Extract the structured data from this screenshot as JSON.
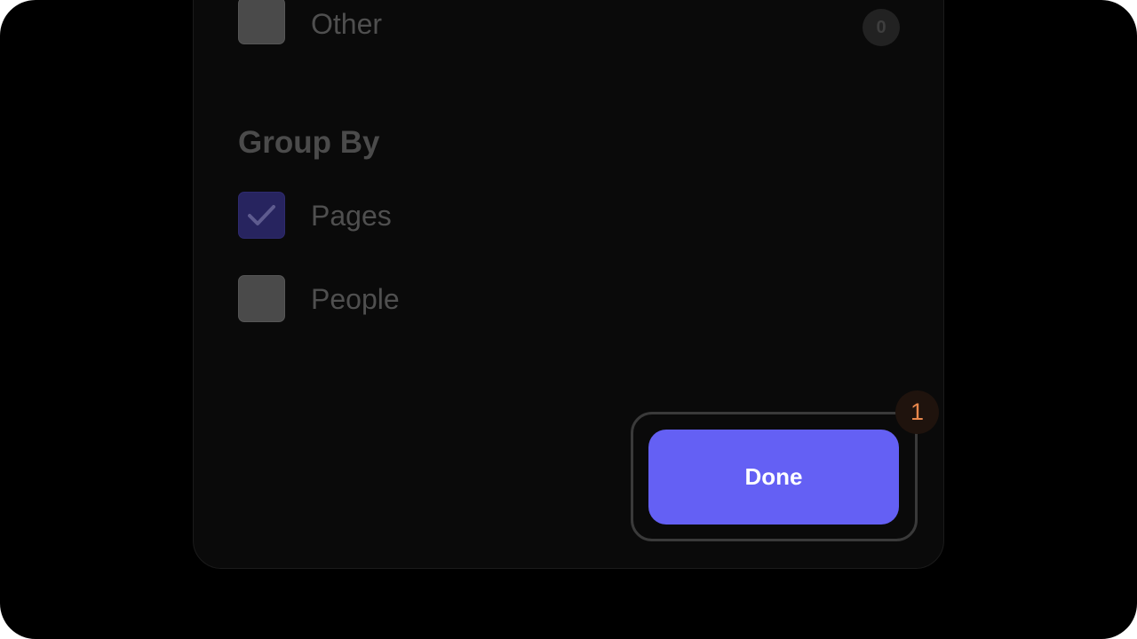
{
  "filters": {
    "other": {
      "label": "Other",
      "checked": false,
      "count": "0"
    }
  },
  "group_by": {
    "heading": "Group By",
    "options": [
      {
        "label": "Pages",
        "checked": true
      },
      {
        "label": "People",
        "checked": false
      }
    ]
  },
  "done_button": {
    "label": "Done"
  },
  "step_badge": {
    "number": "1"
  },
  "colors": {
    "accent": "#6460f4",
    "step_badge_text": "#e8874c",
    "background": "#000000",
    "panel": "#0a0a0a"
  }
}
